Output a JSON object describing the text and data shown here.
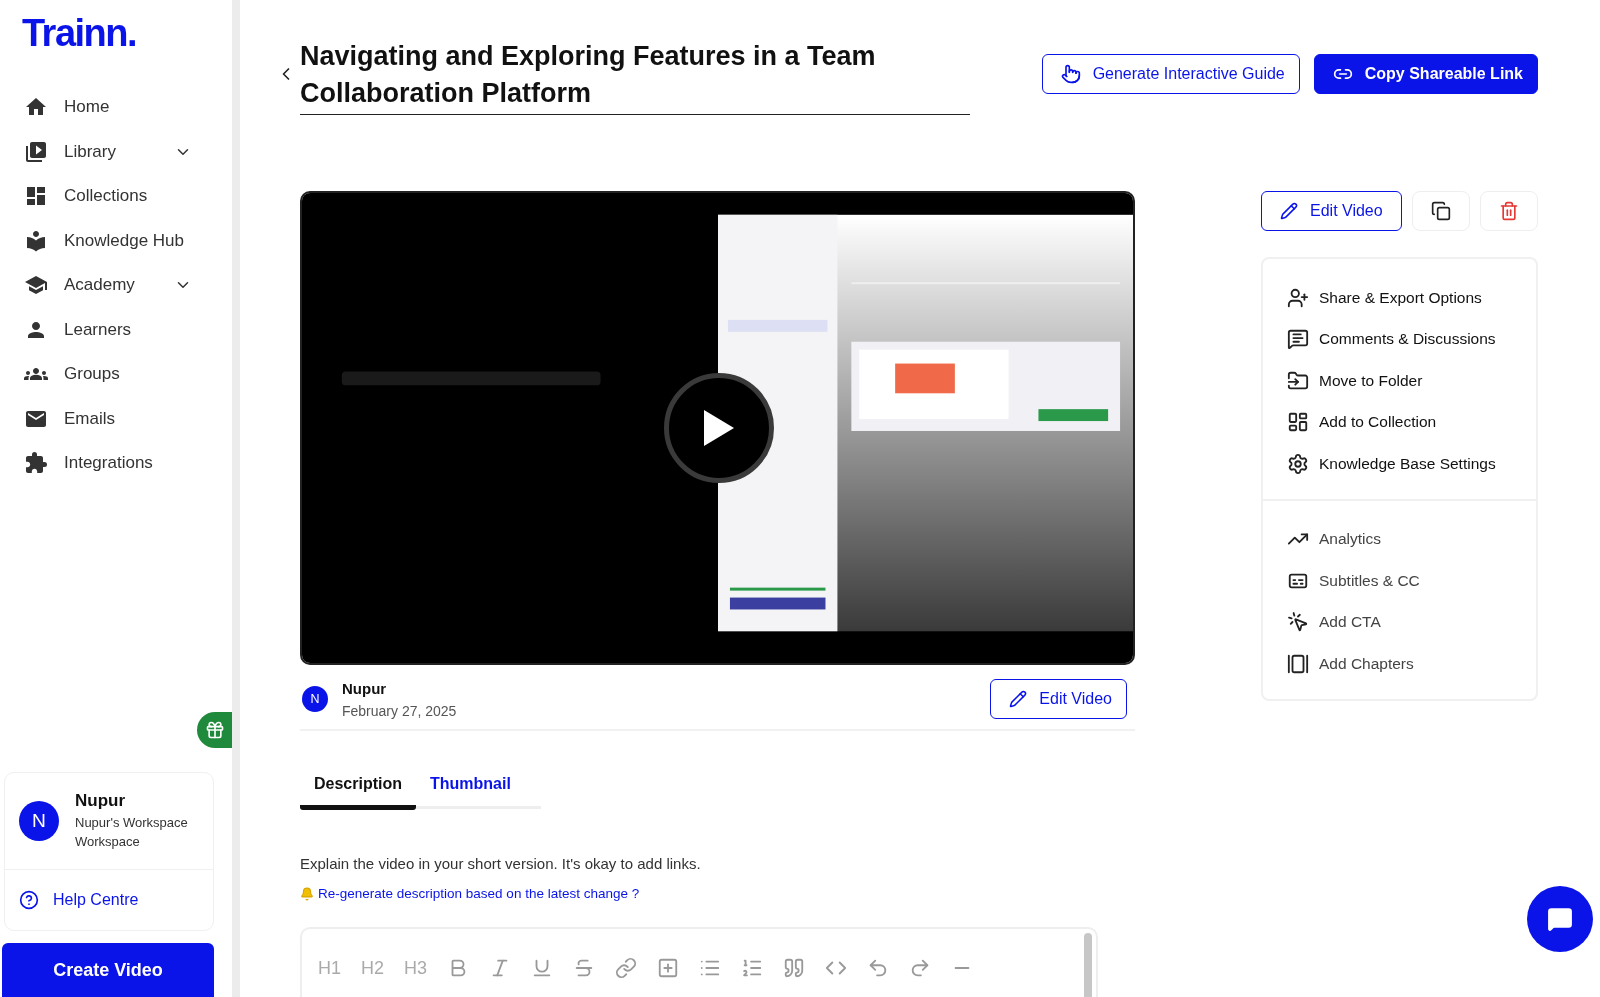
{
  "logo": "Trainn.",
  "sidebar": {
    "items": [
      {
        "label": "Home",
        "kind": "link"
      },
      {
        "label": "Library",
        "kind": "group"
      },
      {
        "label": "Collections",
        "kind": "link"
      },
      {
        "label": "Knowledge Hub",
        "kind": "link"
      },
      {
        "label": "Academy",
        "kind": "group"
      },
      {
        "label": "Learners",
        "kind": "link"
      },
      {
        "label": "Groups",
        "kind": "link"
      },
      {
        "label": "Emails",
        "kind": "link"
      },
      {
        "label": "Integrations",
        "kind": "link"
      }
    ],
    "user": {
      "initial": "N",
      "name": "Nupur",
      "workspace": "Nupur's Workspace Workspace"
    },
    "help": "Help Centre",
    "create_button": "Create Video"
  },
  "header": {
    "title": "Navigating and Exploring Features in a Team Collaboration Platform",
    "guide_button": "Generate Interactive Guide",
    "share_button": "Copy Shareable Link"
  },
  "video": {
    "kind": "picture",
    "author_initial": "N",
    "author": "Nupur",
    "date": "February 27, 2025",
    "edit_button": "Edit Video"
  },
  "tabs": [
    {
      "label": "Description",
      "selected": true
    },
    {
      "label": "Thumbnail",
      "selected": false
    }
  ],
  "description": {
    "hint": "Explain the video in your short version. It's okay to add links.",
    "regenerate": "Re-generate description based on the latest change ?",
    "headings": [
      "H1",
      "H2",
      "H3"
    ]
  },
  "side": {
    "edit_button": "Edit Video",
    "groups": [
      [
        "Share & Export Options",
        "Comments & Discussions",
        "Move to Folder",
        "Add to Collection",
        "Knowledge Base Settings"
      ],
      [
        "Analytics",
        "Subtitles & CC",
        "Add CTA",
        "Add Chapters"
      ]
    ]
  }
}
